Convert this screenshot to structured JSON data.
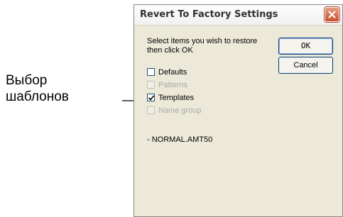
{
  "annotation": {
    "line1": "Выбор",
    "line2": "шаблонов"
  },
  "dialog": {
    "title": "Revert To Factory Settings",
    "prompt": "Select items you wish to restore then click OK",
    "ok_label": "OK",
    "cancel_label": "Cancel",
    "options": [
      {
        "label": "Defaults",
        "checked": false,
        "enabled": true
      },
      {
        "label": "Patterns",
        "checked": false,
        "enabled": false
      },
      {
        "label": "Templates",
        "checked": true,
        "enabled": true
      },
      {
        "label": "Name group",
        "checked": false,
        "enabled": false
      }
    ],
    "selected_file": "- NORMAL.AMT50"
  },
  "colors": {
    "close_button": "#c94f2d",
    "dialog_bg": "#ece9d8",
    "button_border": "#003c74"
  }
}
